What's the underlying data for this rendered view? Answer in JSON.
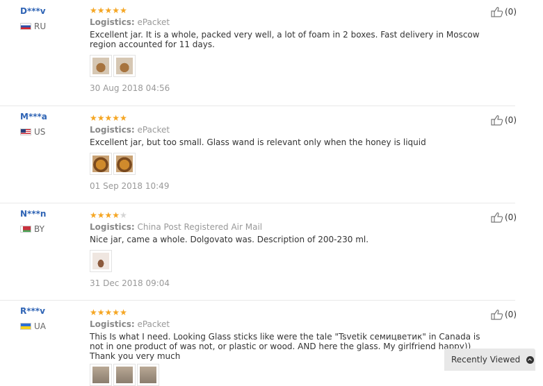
{
  "reviews": [
    {
      "user": "D***v",
      "country": "RU",
      "flag_icon": "russia-flag-icon",
      "rating": 5,
      "logistics_label": "Logistics:",
      "logistics": "ePacket",
      "text": "Excellent jar. It is a whole, packed very well, a lot of foam in 2 boxes. Fast delivery in Moscow region accounted for 11 days.",
      "photos": [
        "review-photo",
        "review-photo"
      ],
      "date": "30 Aug 2018 04:56",
      "helpful": "(0)"
    },
    {
      "user": "M***a",
      "country": "US",
      "flag_icon": "usa-flag-icon",
      "rating": 5,
      "logistics_label": "Logistics:",
      "logistics": "ePacket",
      "text": "Excellent jar, but too small. Glass wand is relevant only when the honey is liquid",
      "photos": [
        "review-photo",
        "review-photo"
      ],
      "date": "01 Sep 2018 10:49",
      "helpful": "(0)"
    },
    {
      "user": "N***n",
      "country": "BY",
      "flag_icon": "belarus-flag-icon",
      "rating": 4,
      "logistics_label": "Logistics:",
      "logistics": "China Post Registered Air Mail",
      "text": "Nice jar, came a whole. Dolgovato was. Description of 200-230 ml.",
      "photos": [
        "review-photo"
      ],
      "date": "31 Dec 2018 09:04",
      "helpful": "(0)"
    },
    {
      "user": "R***v",
      "country": "UA",
      "flag_icon": "ukraine-flag-icon",
      "rating": 5,
      "logistics_label": "Logistics:",
      "logistics": "ePacket",
      "text": "This Is what I need. Looking Glass sticks like were the tale \"Tsvetik семицветик\" in Canada is not in one product of was not, or plastic or wood. AND here the glass. My girlfriend happy)) Thank you very much",
      "photos": [
        "review-photo",
        "review-photo",
        "review-photo"
      ],
      "helpful": "(0)"
    }
  ],
  "colors": {
    "star": "#f5a623",
    "star_off": "#d4d4d4",
    "username": "#2f64b5",
    "muted": "#999999"
  },
  "recently_viewed": {
    "label": "Recently Viewed",
    "icon": "chevron-up-circle-icon"
  }
}
